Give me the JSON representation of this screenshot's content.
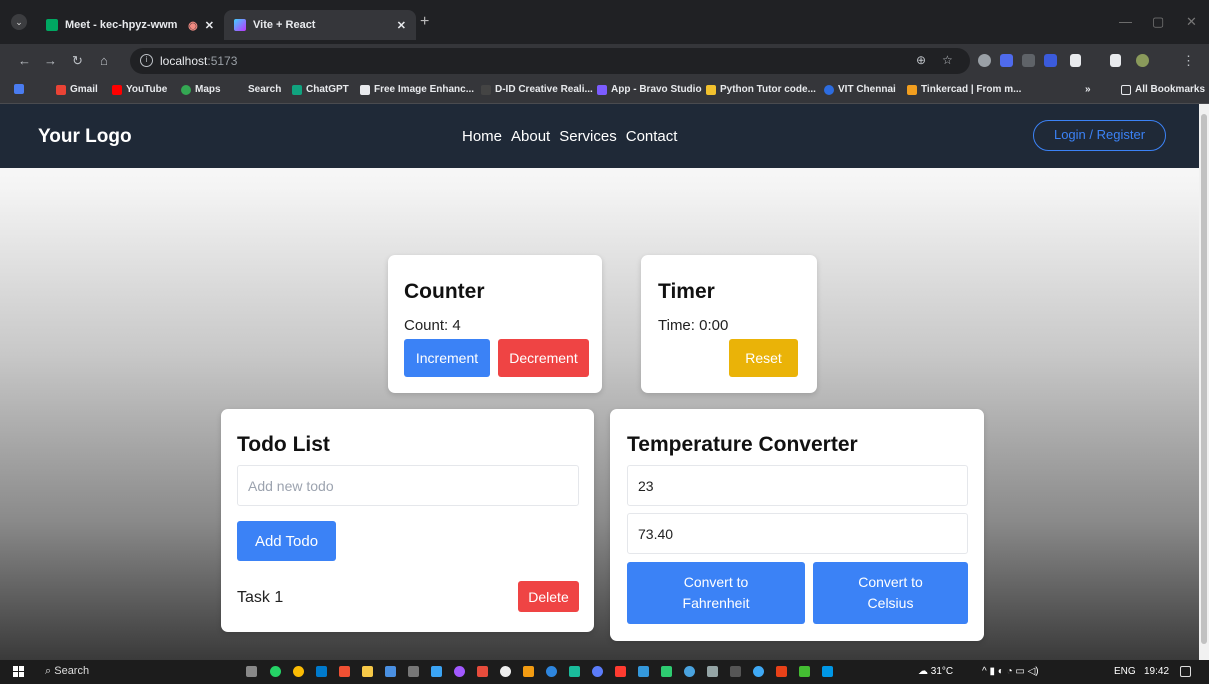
{
  "browser": {
    "tabs": [
      {
        "title": "Meet - kec-hpyz-wwm",
        "active": false
      },
      {
        "title": "Vite + React",
        "active": true
      }
    ],
    "url_host": "localhost",
    "url_port": ":5173",
    "bookmarks": [
      "Gmail",
      "YouTube",
      "Maps",
      "Search",
      "ChatGPT",
      "Free Image Enhanc...",
      "D-ID Creative Reali...",
      "App - Bravo Studio",
      "Python Tutor code...",
      "VIT Chennai",
      "Tinkercad | From m..."
    ],
    "bookmarks_overflow": "»",
    "all_bookmarks": "All Bookmarks"
  },
  "site": {
    "logo": "Your Logo",
    "nav": [
      "Home",
      "About",
      "Services",
      "Contact"
    ],
    "login": "Login / Register"
  },
  "counter": {
    "title": "Counter",
    "count_text": "Count: 4",
    "increment": "Increment",
    "decrement": "Decrement"
  },
  "timer": {
    "title": "Timer",
    "time_text": "Time: 0:00",
    "reset": "Reset"
  },
  "todo": {
    "title": "Todo List",
    "placeholder": "Add new todo",
    "add": "Add Todo",
    "items": [
      {
        "text": "Task 1",
        "delete": "Delete"
      }
    ]
  },
  "temperature": {
    "title": "Temperature Converter",
    "celsius_value": "23",
    "fahrenheit_value": "73.40",
    "to_f_line1": "Convert to",
    "to_f_line2": "Fahrenheit",
    "to_c_line1": "Convert to",
    "to_c_line2": "Celsius"
  },
  "taskbar": {
    "search": "Search",
    "weather": "31°C",
    "lang": "ENG",
    "time": "19:42"
  },
  "colors": {
    "nav_bg": "#1f2937",
    "primary": "#3b82f6",
    "danger": "#ef4444",
    "warning": "#eab308"
  }
}
